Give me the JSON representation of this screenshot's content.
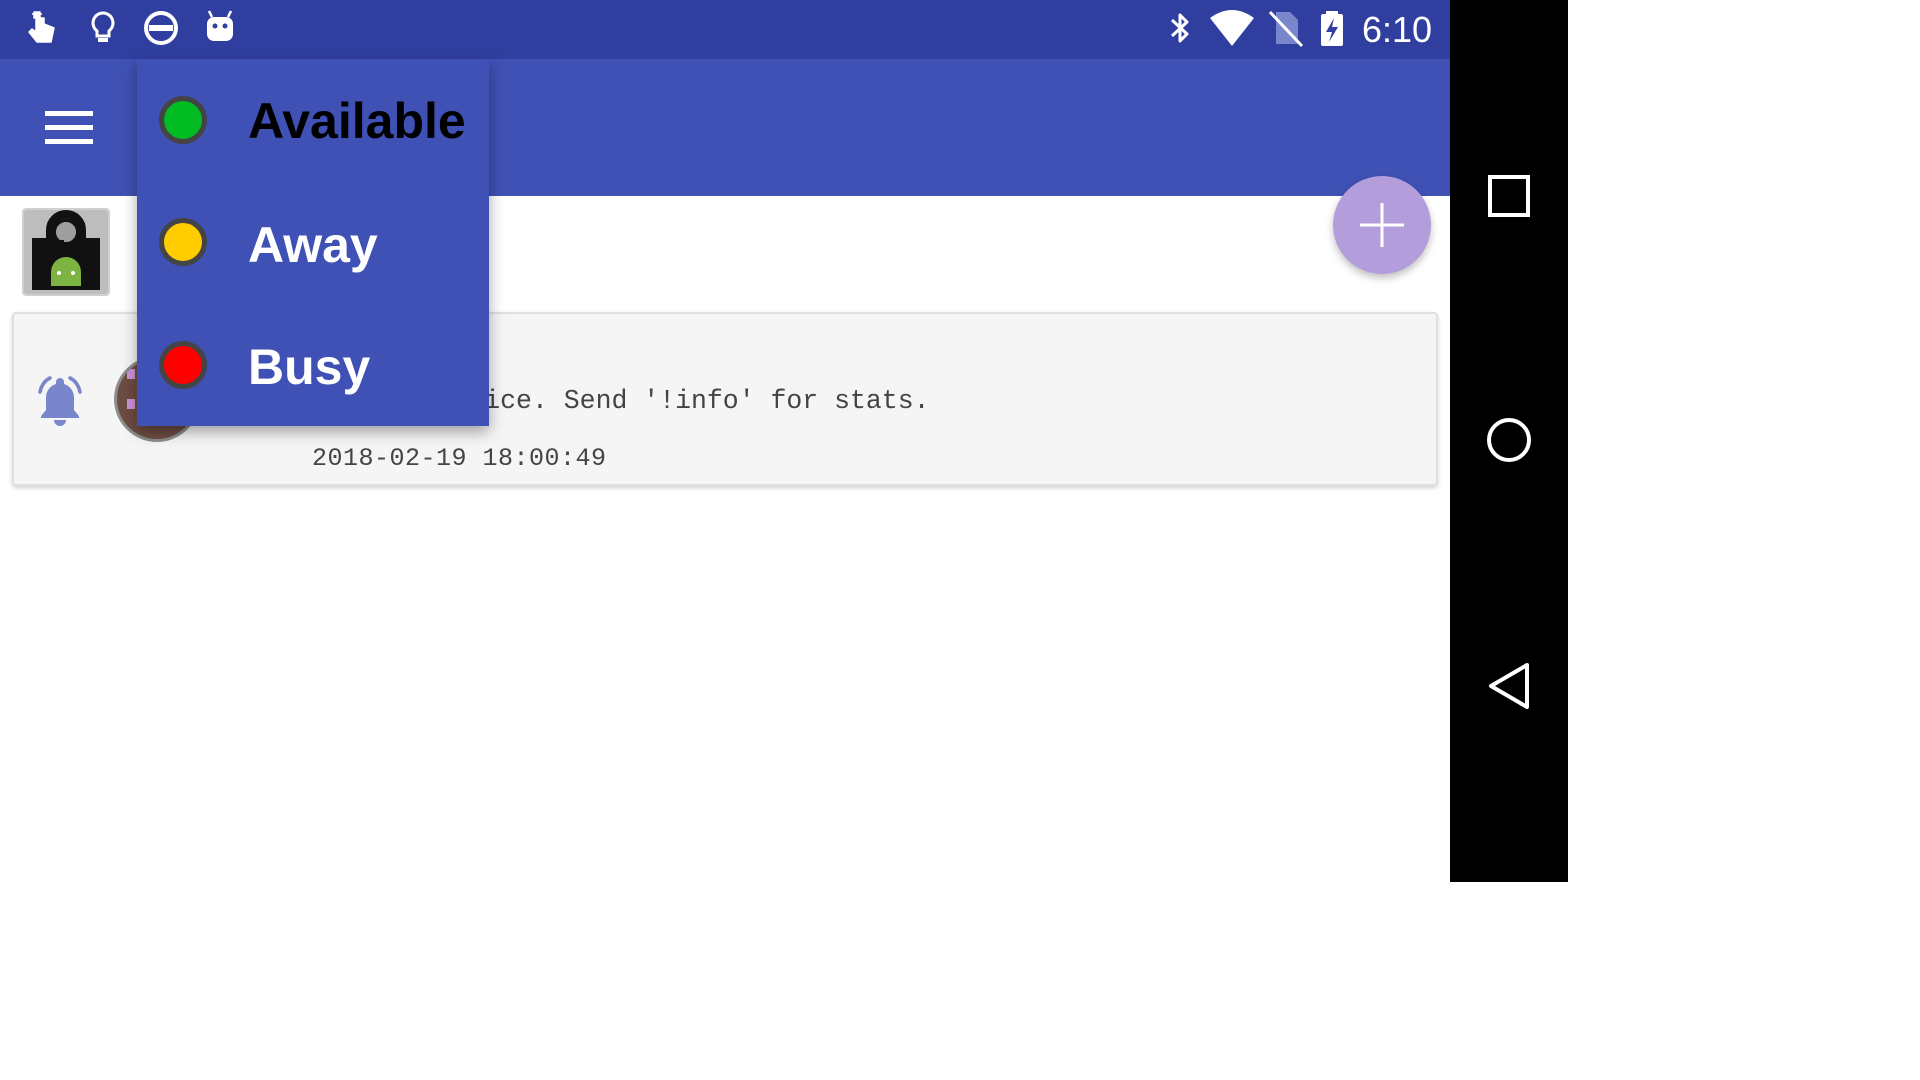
{
  "status_bar": {
    "time": "6:10",
    "left_icons": [
      "touch-icon",
      "lightbulb-icon",
      "do-not-disturb-icon",
      "android-debug-icon"
    ],
    "right_icons": [
      "bluetooth-icon",
      "wifi-icon",
      "no-sim-icon",
      "battery-charging-icon"
    ]
  },
  "app_bar": {
    "menu_icon": "hamburger-menu-icon"
  },
  "status_menu": {
    "items": [
      {
        "label": "Available",
        "color": "#00bb22",
        "text_color": "#000000"
      },
      {
        "label": "Away",
        "color": "#ffcc00",
        "text_color": "#ffffff"
      },
      {
        "label": "Busy",
        "color": "#ff0000",
        "text_color": "#ffffff"
      }
    ]
  },
  "notification": {
    "message": "video testing service. Send '!info' for stats.",
    "timestamp": "2018-02-19 18:00:49"
  },
  "fab": {
    "icon": "plus-icon",
    "color": "#b39ddb"
  },
  "colors": {
    "primary": "#3f51b5",
    "primary_dark": "#303f9f",
    "accent": "#b39ddb"
  }
}
